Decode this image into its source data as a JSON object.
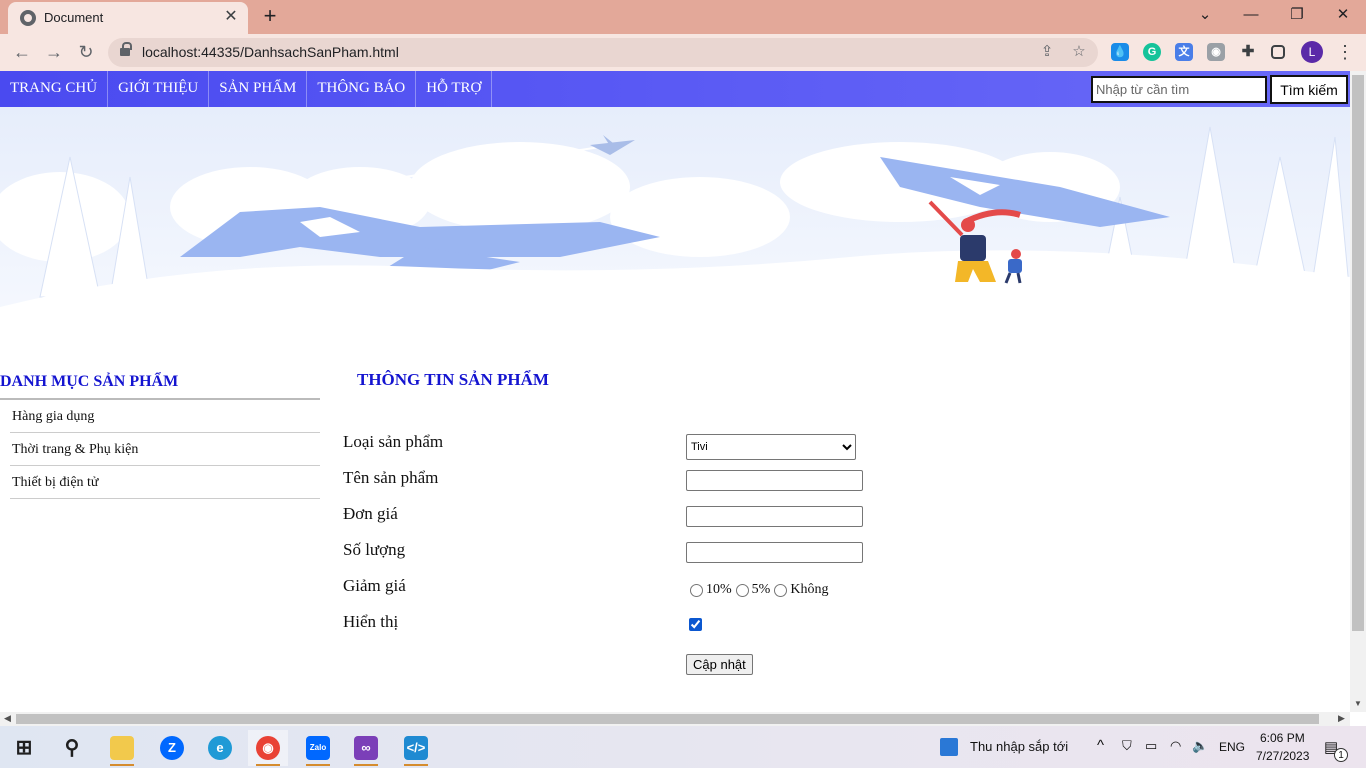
{
  "browser": {
    "tab_title": "Document",
    "url": "localhost:44335/DanhsachSanPham.html",
    "profile_initial": "L"
  },
  "site": {
    "nav": [
      "TRANG CHỦ",
      "GIỚI THIỆU",
      "SẢN PHẨM",
      "THÔNG BÁO",
      "HỖ TRỢ"
    ],
    "search_placeholder": "Nhập từ cần tìm",
    "search_button": "Tìm kiếm"
  },
  "sidebar": {
    "title": "DANH MỤC SẢN PHẨM",
    "items": [
      "Hàng gia dụng",
      "Thời trang & Phụ kiện",
      "Thiết bị điện tử"
    ]
  },
  "form": {
    "title": "THÔNG TIN SẢN PHẨM",
    "labels": {
      "category": "Loại sản phẩm",
      "name": "Tên sản phẩm",
      "price": "Đơn giá",
      "quantity": "Số lượng",
      "discount": "Giảm giá",
      "visible": "Hiển thị"
    },
    "category_selected": "Tivi",
    "discount_options": [
      "10%",
      "5%",
      "Không"
    ],
    "visible_checked": true,
    "submit": "Cập nhật"
  },
  "taskbar": {
    "news": "Thu nhập sắp tới",
    "lang": "ENG",
    "time": "6:06 PM",
    "date": "7/27/2023",
    "notif_count": "1"
  },
  "colors": {
    "titlebar": "#e3a899",
    "site_nav": "#5a5af4",
    "heading": "#1414d0"
  }
}
